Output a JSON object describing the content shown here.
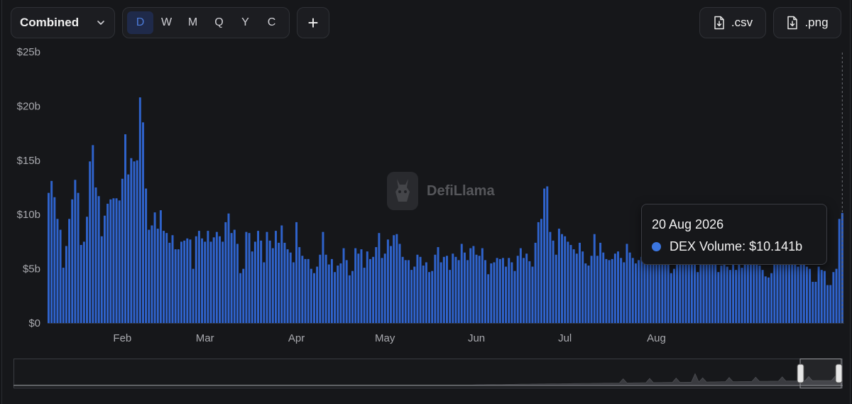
{
  "toolbar": {
    "combined_label": "Combined",
    "periods": [
      "D",
      "W",
      "M",
      "Q",
      "Y",
      "C"
    ],
    "active_period": "D",
    "plus_label": "+",
    "csv_label": ".csv",
    "png_label": ".png"
  },
  "watermark": {
    "text": "DefiLlama"
  },
  "tooltip": {
    "date": "20 Aug 2026",
    "series": "DEX Volume",
    "value": "$10.141b",
    "color": "#3b76e0"
  },
  "colors": {
    "bar": "#2f63cc",
    "accent": "#3b76e0",
    "background": "#16171a"
  },
  "chart_data": {
    "type": "bar",
    "x_start": "2026-01-07",
    "x_end": "2026-08-20",
    "x_tick_labels": [
      "Feb",
      "Mar",
      "Apr",
      "May",
      "Jun",
      "Jul",
      "Aug"
    ],
    "y_tick_labels": [
      "$0",
      "$5b",
      "$10b",
      "$15b",
      "$20b",
      "$25b"
    ],
    "ylim": [
      0,
      25
    ],
    "grid": false,
    "series": [
      {
        "name": "DEX Volume",
        "values": [
          12.0,
          13.1,
          11.6,
          9.6,
          8.6,
          5.1,
          7.1,
          9.6,
          11.4,
          13.2,
          12.0,
          7.2,
          7.5,
          9.8,
          14.9,
          16.4,
          12.5,
          11.7,
          8.0,
          9.9,
          11.0,
          11.4,
          11.5,
          11.5,
          11.3,
          13.3,
          17.4,
          13.7,
          15.2,
          14.9,
          15.0,
          20.8,
          18.5,
          12.4,
          8.6,
          9.0,
          10.2,
          8.7,
          10.4,
          8.5,
          8.3,
          7.4,
          8.1,
          6.8,
          6.8,
          7.5,
          7.6,
          7.8,
          7.7,
          5.0,
          8.0,
          8.5,
          7.8,
          7.5,
          8.5,
          7.5,
          7.9,
          8.4,
          8.0,
          7.5,
          9.3,
          10.1,
          8.3,
          8.6,
          7.3,
          4.6,
          5.0,
          8.4,
          8.3,
          6.6,
          7.5,
          8.5,
          7.6,
          5.6,
          8.4,
          7.6,
          6.9,
          8.5,
          7.4,
          9.0,
          7.4,
          6.8,
          6.5,
          5.6,
          9.3,
          7.0,
          6.2,
          5.9,
          5.9,
          5.0,
          4.6,
          5.2,
          6.3,
          8.4,
          6.3,
          5.4,
          5.9,
          4.7,
          5.3,
          5.5,
          6.9,
          5.8,
          4.4,
          4.8,
          6.9,
          6.4,
          6.8,
          5.1,
          6.6,
          5.9,
          6.1,
          7.0,
          8.3,
          6.0,
          6.4,
          7.7,
          7.1,
          8.1,
          8.2,
          7.3,
          6.1,
          5.8,
          5.8,
          4.9,
          5.2,
          6.3,
          6.1,
          5.3,
          5.6,
          4.7,
          4.8,
          6.3,
          7.0,
          5.6,
          6.1,
          6.2,
          4.9,
          6.4,
          6.1,
          5.8,
          7.3,
          6.5,
          5.8,
          6.9,
          7.1,
          6.3,
          6.2,
          6.9,
          5.8,
          4.5,
          5.5,
          5.6,
          6.0,
          5.9,
          6.0,
          5.2,
          6.0,
          5.6,
          4.8,
          6.2,
          6.9,
          6.0,
          6.4,
          5.7,
          5.2,
          7.4,
          9.3,
          9.6,
          12.4,
          12.6,
          8.4,
          7.6,
          6.3,
          8.7,
          8.2,
          8.0,
          7.5,
          7.2,
          6.8,
          6.4,
          7.4,
          6.6,
          5.5,
          5.3,
          6.2,
          8.2,
          6.2,
          7.4,
          6.5,
          5.9,
          5.8,
          5.9,
          6.4,
          6.6,
          6.0,
          5.6,
          7.3,
          6.5,
          6.0,
          5.5,
          5.8,
          6.1,
          6.8,
          7.0,
          5.9,
          6.9,
          5.9,
          7.0,
          5.9,
          6.3,
          6.2,
          4.6,
          5.0,
          6.5,
          6.0,
          7.0,
          5.8,
          6.1,
          6.3,
          5.6,
          4.7,
          5.4,
          7.5,
          6.9,
          6.8,
          6.7,
          6.3,
          4.7,
          5.3,
          7.4,
          5.2,
          4.9,
          5.6,
          4.9,
          6.0,
          5.1,
          5.5,
          6.1,
          7.1,
          6.0,
          5.8,
          5.3,
          4.9,
          4.3,
          4.2,
          4.6,
          6.1,
          7.4,
          6.3,
          5.7,
          5.9,
          6.6,
          7.8,
          5.9,
          5.2,
          6.4,
          6.5,
          5.2,
          5.0,
          3.8,
          3.8,
          5.2,
          4.9,
          4.8,
          3.5,
          3.5,
          4.7,
          5.0,
          9.6,
          10.141
        ]
      }
    ]
  }
}
